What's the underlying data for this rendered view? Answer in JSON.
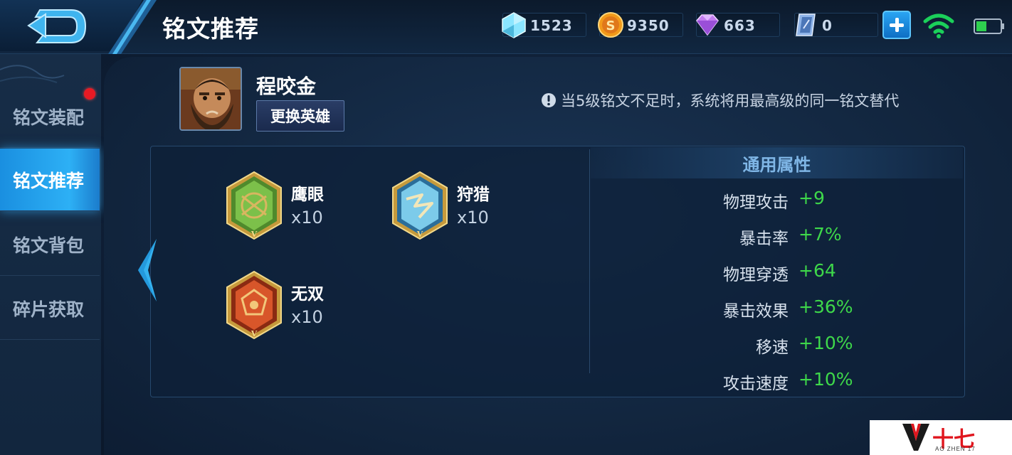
{
  "header": {
    "title": "铭文推荐",
    "back_icon": "back-arrow-icon"
  },
  "currencies": [
    {
      "icon": "crystal-coupon-icon",
      "value": "1523",
      "color": "#7fd8f2"
    },
    {
      "icon": "gold-coin-icon",
      "value": "9350",
      "color": "#f2a21a"
    },
    {
      "icon": "diamond-icon",
      "value": "663",
      "color": "#c27cf0"
    },
    {
      "icon": "voucher-icon",
      "value": "0",
      "color": "#8fb4e8"
    }
  ],
  "status": {
    "add_icon": "plus-icon",
    "wifi_icon": "wifi-icon",
    "battery_icon": "battery-icon"
  },
  "sidebar": {
    "items": [
      {
        "label": "铭文装配",
        "has_badge": true
      },
      {
        "label": "铭文推荐",
        "active": true
      },
      {
        "label": "铭文背包"
      },
      {
        "label": "碎片获取"
      }
    ]
  },
  "hero": {
    "name": "程咬金",
    "change_button": "更换英雄"
  },
  "notice": "当5级铭文不足时，系统将用最高级的同一铭文替代",
  "runes": [
    {
      "name": "鹰眼",
      "count": "x10",
      "color": "green",
      "level": "V"
    },
    {
      "name": "狩猎",
      "count": "x10",
      "color": "blue",
      "level": "V"
    },
    {
      "name": "无双",
      "count": "x10",
      "color": "red",
      "level": "V"
    }
  ],
  "attributes": {
    "header": "通用属性",
    "rows": [
      {
        "name": "物理攻击",
        "value": "+9"
      },
      {
        "name": "暴击率",
        "value": "+7%"
      },
      {
        "name": "物理穿透",
        "value": "+64"
      },
      {
        "name": "暴击效果",
        "value": "+36%"
      },
      {
        "name": "移速",
        "value": "+10%"
      },
      {
        "name": "攻击速度",
        "value": "+10%"
      }
    ]
  },
  "watermark": {
    "text": "十七",
    "subtext": "AO ZHEN 17"
  }
}
